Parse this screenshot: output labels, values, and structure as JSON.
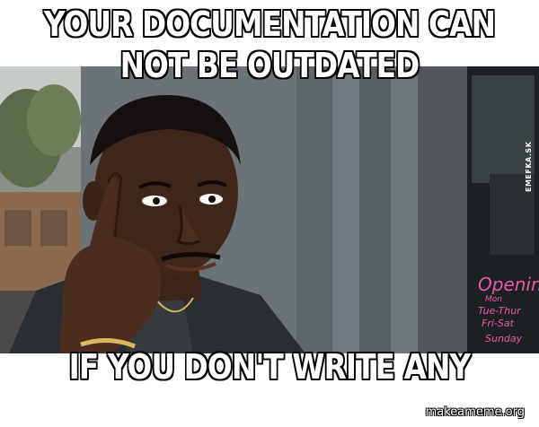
{
  "meme": {
    "top_caption_line1": "YOUR DOCUMENTATION CAN",
    "top_caption_line2": "NOT BE OUTDATED",
    "bottom_caption": "IF YOU DON'T WRITE ANY",
    "side_watermark": "EMEFKA.SK",
    "bottom_watermark": "makeameme.org",
    "window_sign": {
      "title": "Opening",
      "lines": [
        "Mon",
        "Tue-Thur",
        "Fri-Sat",
        "Sunday"
      ]
    }
  },
  "colors": {
    "caption_fill": "#ffffff",
    "caption_stroke": "#000000",
    "sign_text": "#e85aa8",
    "background": "#ffffff"
  }
}
